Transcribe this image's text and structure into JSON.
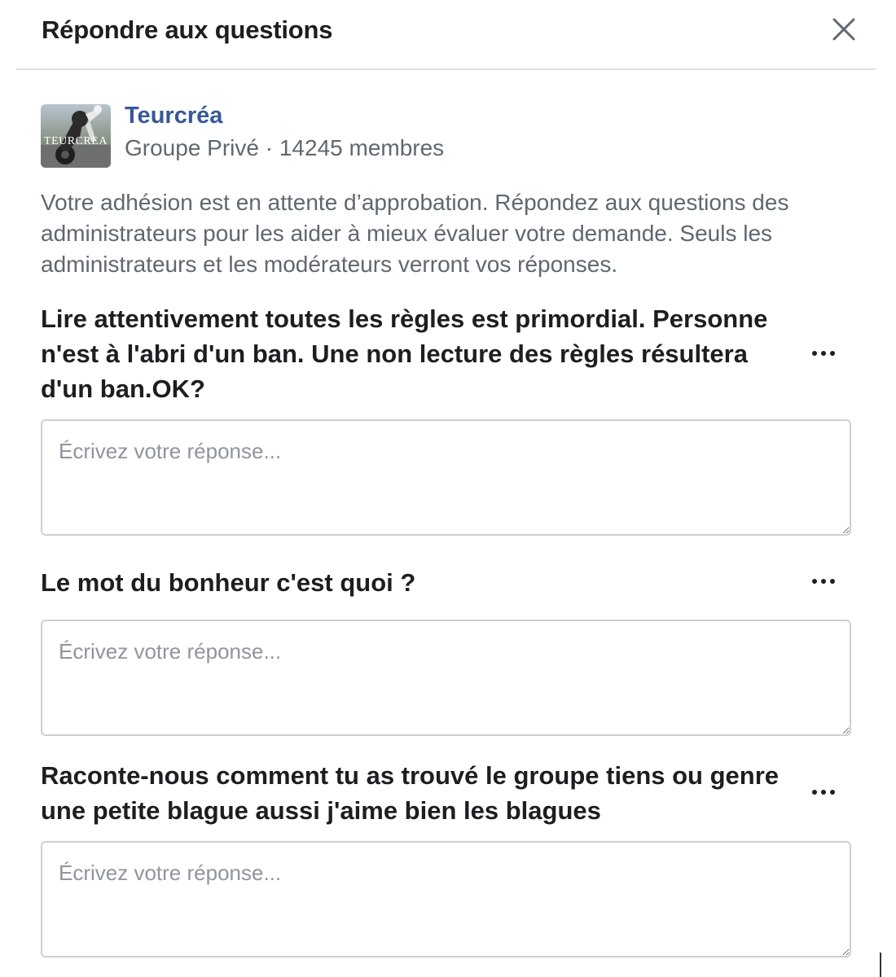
{
  "dialog": {
    "title": "Répondre aux questions",
    "close_icon": "close-icon"
  },
  "group": {
    "name": "Teurcréa",
    "avatar_text": "TEURCREA",
    "meta": "Groupe Privé · 14245 membres"
  },
  "intro": "Votre adhésion est en attente d’approbation. Répondez aux questions des administrateurs pour les aider à mieux évaluer votre demande. Seuls les administrateurs et les modérateurs verront vos réponses.",
  "questions": [
    {
      "text": "Lire attentivement toutes les règles est primordial. Personne n'est à l'abri d'un ban. Une non lecture des règles résultera d'un ban.OK?",
      "placeholder": "Écrivez votre réponse...",
      "value": ""
    },
    {
      "text": "Le mot du bonheur c'est quoi ?",
      "placeholder": "Écrivez votre réponse...",
      "value": ""
    },
    {
      "text": "Raconte-nous comment tu as trouvé le groupe tiens ou genre une petite blague aussi j'aime bien les blagues",
      "placeholder": "Écrivez votre réponse...",
      "value": ""
    }
  ],
  "colors": {
    "link": "#385898",
    "secondary_text": "#606770",
    "border": "#ccd0d5",
    "divider": "#dddfe2"
  }
}
